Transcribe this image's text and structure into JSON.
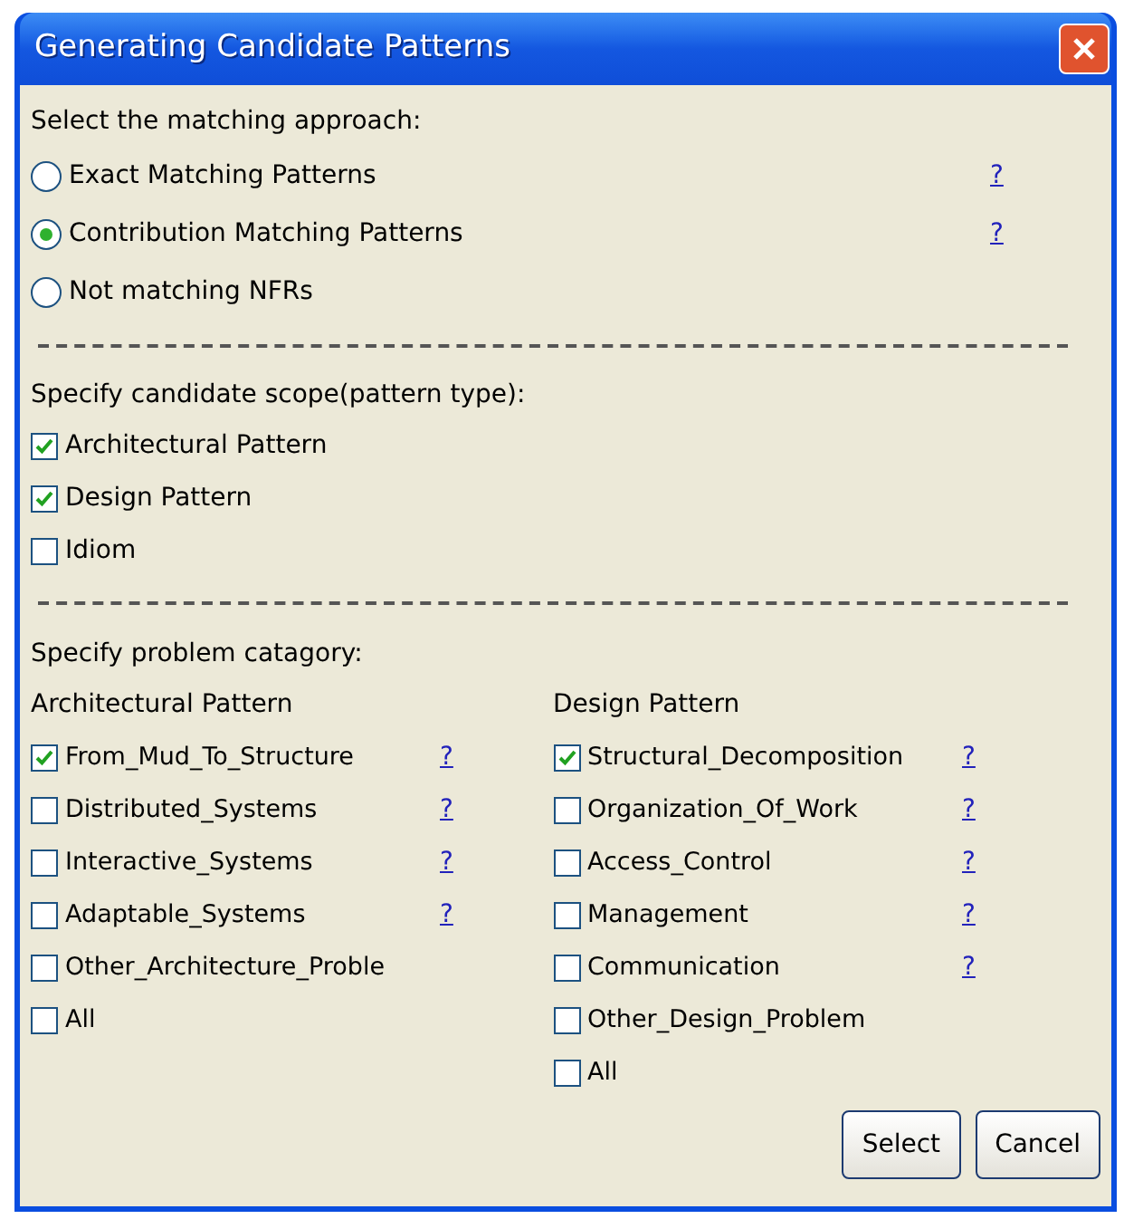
{
  "window": {
    "title": "Generating Candidate Patterns"
  },
  "approach": {
    "heading": "Select the matching approach:",
    "options": [
      {
        "label": "Exact Matching Patterns",
        "selected": false,
        "help": "?"
      },
      {
        "label": "Contribution Matching Patterns",
        "selected": true,
        "help": "?"
      },
      {
        "label": "Not matching NFRs",
        "selected": false
      }
    ]
  },
  "scope": {
    "heading": "Specify candidate scope(pattern type):",
    "options": [
      {
        "label": "Architectural Pattern",
        "checked": true
      },
      {
        "label": "Design Pattern",
        "checked": true
      },
      {
        "label": "Idiom",
        "checked": false
      }
    ]
  },
  "category": {
    "heading": "Specify problem catagory:",
    "columns": [
      {
        "title": "Architectural Pattern",
        "items": [
          {
            "label": "From_Mud_To_Structure",
            "checked": true,
            "help": "?"
          },
          {
            "label": "Distributed_Systems",
            "checked": false,
            "help": "?"
          },
          {
            "label": "Interactive_Systems",
            "checked": false,
            "help": "?"
          },
          {
            "label": "Adaptable_Systems",
            "checked": false,
            "help": "?"
          },
          {
            "label": "Other_Architecture_Proble",
            "checked": false
          },
          {
            "label": "All",
            "checked": false
          }
        ]
      },
      {
        "title": "Design Pattern",
        "items": [
          {
            "label": "Structural_Decomposition",
            "checked": true,
            "help": "?"
          },
          {
            "label": "Organization_Of_Work",
            "checked": false,
            "help": "?"
          },
          {
            "label": "Access_Control",
            "checked": false,
            "help": "?"
          },
          {
            "label": "Management",
            "checked": false,
            "help": "?"
          },
          {
            "label": "Communication",
            "checked": false,
            "help": "?"
          },
          {
            "label": "Other_Design_Problem",
            "checked": false
          },
          {
            "label": "All",
            "checked": false
          }
        ]
      }
    ]
  },
  "buttons": [
    "Select",
    "Cancel"
  ]
}
